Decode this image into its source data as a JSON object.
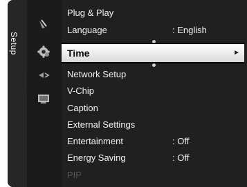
{
  "side_label": "Setup",
  "categories": [
    {
      "icon": "antenna-icon"
    },
    {
      "icon": "gear-icon"
    },
    {
      "icon": "speaker-icon"
    },
    {
      "icon": "tv-icon"
    }
  ],
  "menu": {
    "items": [
      {
        "label": "Plug & Play",
        "value": ""
      },
      {
        "label": "Language",
        "value": ": English"
      },
      {
        "label": "Time",
        "value": "",
        "arrow": "►"
      },
      {
        "label": "Network Setup",
        "value": ""
      },
      {
        "label": "V-Chip",
        "value": ""
      },
      {
        "label": "Caption",
        "value": ""
      },
      {
        "label": "External Settings",
        "value": ""
      },
      {
        "label": "Entertainment",
        "value": ": Off"
      },
      {
        "label": "Energy Saving",
        "value": ": Off"
      },
      {
        "label": "PIP",
        "value": ""
      }
    ]
  },
  "colors": {
    "background": "#000000",
    "selected_gradient_top": "#ffffff",
    "selected_text": "#000000",
    "text": "#f2f2f2",
    "disabled_text": "#555555"
  }
}
